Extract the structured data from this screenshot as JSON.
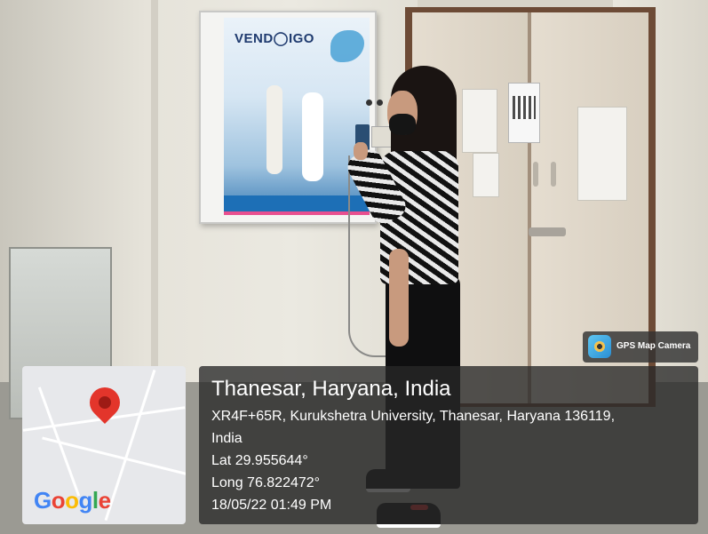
{
  "vending_machine": {
    "brand": "VEND◯IGO"
  },
  "gps_badge": {
    "label": "GPS Map Camera"
  },
  "map": {
    "logo_letters": [
      {
        "ch": "G",
        "color": "#4285F4"
      },
      {
        "ch": "o",
        "color": "#EA4335"
      },
      {
        "ch": "o",
        "color": "#FBBC05"
      },
      {
        "ch": "g",
        "color": "#4285F4"
      },
      {
        "ch": "l",
        "color": "#34A853"
      },
      {
        "ch": "e",
        "color": "#EA4335"
      }
    ],
    "pin_color": "#E3352B"
  },
  "location": {
    "title": "Thanesar, Haryana, India",
    "address_line1": "XR4F+65R, Kurukshetra University, Thanesar, Haryana 136119,",
    "address_line2": "India",
    "lat": "Lat 29.955644°",
    "long": "Long 76.822472°",
    "datetime": "18/05/22 01:49 PM"
  }
}
